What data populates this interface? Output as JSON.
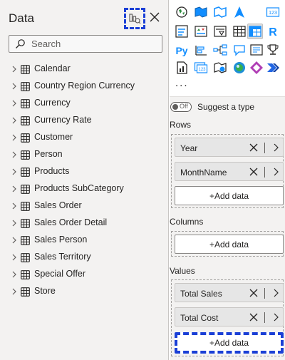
{
  "data_pane": {
    "title": "Data",
    "search_placeholder": "Search",
    "tables": [
      {
        "name": "Calendar"
      },
      {
        "name": "Country Region Currency"
      },
      {
        "name": "Currency"
      },
      {
        "name": "Currency Rate"
      },
      {
        "name": "Customer"
      },
      {
        "name": "Person"
      },
      {
        "name": "Products"
      },
      {
        "name": "Products SubCategory"
      },
      {
        "name": "Sales Order"
      },
      {
        "name": "Sales Order Detail"
      },
      {
        "name": "Sales Person"
      },
      {
        "name": "Sales Territory"
      },
      {
        "name": "Special Offer"
      },
      {
        "name": "Store"
      }
    ]
  },
  "viz_pane": {
    "icons": [
      "globe-map-icon",
      "filled-map-icon",
      "shape-map-icon",
      "arrow-nav-icon",
      "card-123-icon",
      "multi-row-card-icon",
      "kpi-icon",
      "slicer-icon",
      "table-icon",
      "matrix-icon",
      "r-visual-icon",
      "python-visual-icon",
      "key-influencers-icon",
      "decomposition-tree-icon",
      "qa-icon",
      "smart-narrative-icon",
      "trophy-icon",
      "paginated-report-icon",
      "card-new-icon",
      "azure-map-icon",
      "arcgis-map-icon",
      "power-apps-icon",
      "power-automate-icon"
    ],
    "more_label": "...",
    "suggest_toggle_label": "Off",
    "suggest_label": "Suggest a type",
    "rows": {
      "label": "Rows",
      "fields": [
        "Year",
        "MonthName"
      ],
      "add_label": "+Add data"
    },
    "columns": {
      "label": "Columns",
      "add_label": "+Add data"
    },
    "values": {
      "label": "Values",
      "fields": [
        "Total Sales",
        "Total Cost"
      ],
      "add_label": "+Add data"
    }
  },
  "colors": {
    "focus_outline": "#1a3fd6",
    "pane_bg": "#f3f2f1",
    "accent_blue": "#118dff",
    "accent_orange": "#e8a200"
  }
}
